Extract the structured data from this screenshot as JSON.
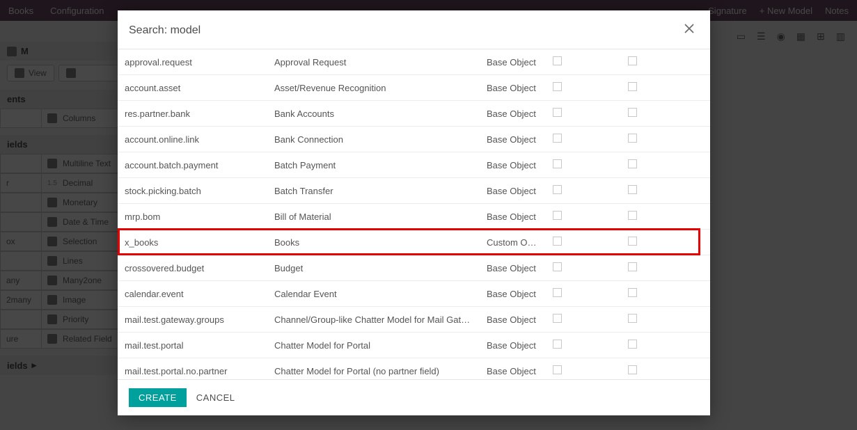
{
  "background": {
    "topmenu": {
      "books": "Books",
      "config": "Configuration"
    },
    "right_tools": {
      "signature": "Signature",
      "new_model": "+ New Model",
      "notes": "Notes"
    },
    "breadcrumb": "M",
    "view_btn": "View",
    "section_ents": "ents",
    "section_fields": "ields ",
    "columns_btn": "Columns",
    "palette": [
      {
        "left": "",
        "right": "Multiline Text"
      },
      {
        "left": "r",
        "right": "Decimal"
      },
      {
        "left": "",
        "right": "Monetary"
      },
      {
        "left": "",
        "right": "Date & Time"
      },
      {
        "left": "ox",
        "right": "Selection"
      },
      {
        "left": "",
        "right": "Lines"
      },
      {
        "left": "any",
        "right": "Many2one"
      },
      {
        "left": "2many",
        "right": "Image"
      },
      {
        "left": "",
        "right": "Priority"
      },
      {
        "left": "ure",
        "right": "Related Field"
      }
    ],
    "decimal_prefix": "1.5"
  },
  "modal": {
    "title": "Search: model",
    "create": "CREATE",
    "cancel": "CANCEL",
    "rows": [
      {
        "model": "approval.request",
        "desc": "Approval Request",
        "type": "Base Object"
      },
      {
        "model": "account.asset",
        "desc": "Asset/Revenue Recognition",
        "type": "Base Object"
      },
      {
        "model": "res.partner.bank",
        "desc": "Bank Accounts",
        "type": "Base Object"
      },
      {
        "model": "account.online.link",
        "desc": "Bank Connection",
        "type": "Base Object"
      },
      {
        "model": "account.batch.payment",
        "desc": "Batch Payment",
        "type": "Base Object"
      },
      {
        "model": "stock.picking.batch",
        "desc": "Batch Transfer",
        "type": "Base Object"
      },
      {
        "model": "mrp.bom",
        "desc": "Bill of Material",
        "type": "Base Object"
      },
      {
        "model": "x_books",
        "desc": "Books",
        "type": "Custom Object",
        "highlight": true
      },
      {
        "model": "crossovered.budget",
        "desc": "Budget",
        "type": "Base Object"
      },
      {
        "model": "calendar.event",
        "desc": "Calendar Event",
        "type": "Base Object"
      },
      {
        "model": "mail.test.gateway.groups",
        "desc": "Channel/Group-like Chatter Model for Mail Gateway",
        "type": "Base Object"
      },
      {
        "model": "mail.test.portal",
        "desc": "Chatter Model for Portal",
        "type": "Base Object"
      },
      {
        "model": "mail.test.portal.no.partner",
        "desc": "Chatter Model for Portal (no partner field)",
        "type": "Base Object"
      }
    ]
  }
}
